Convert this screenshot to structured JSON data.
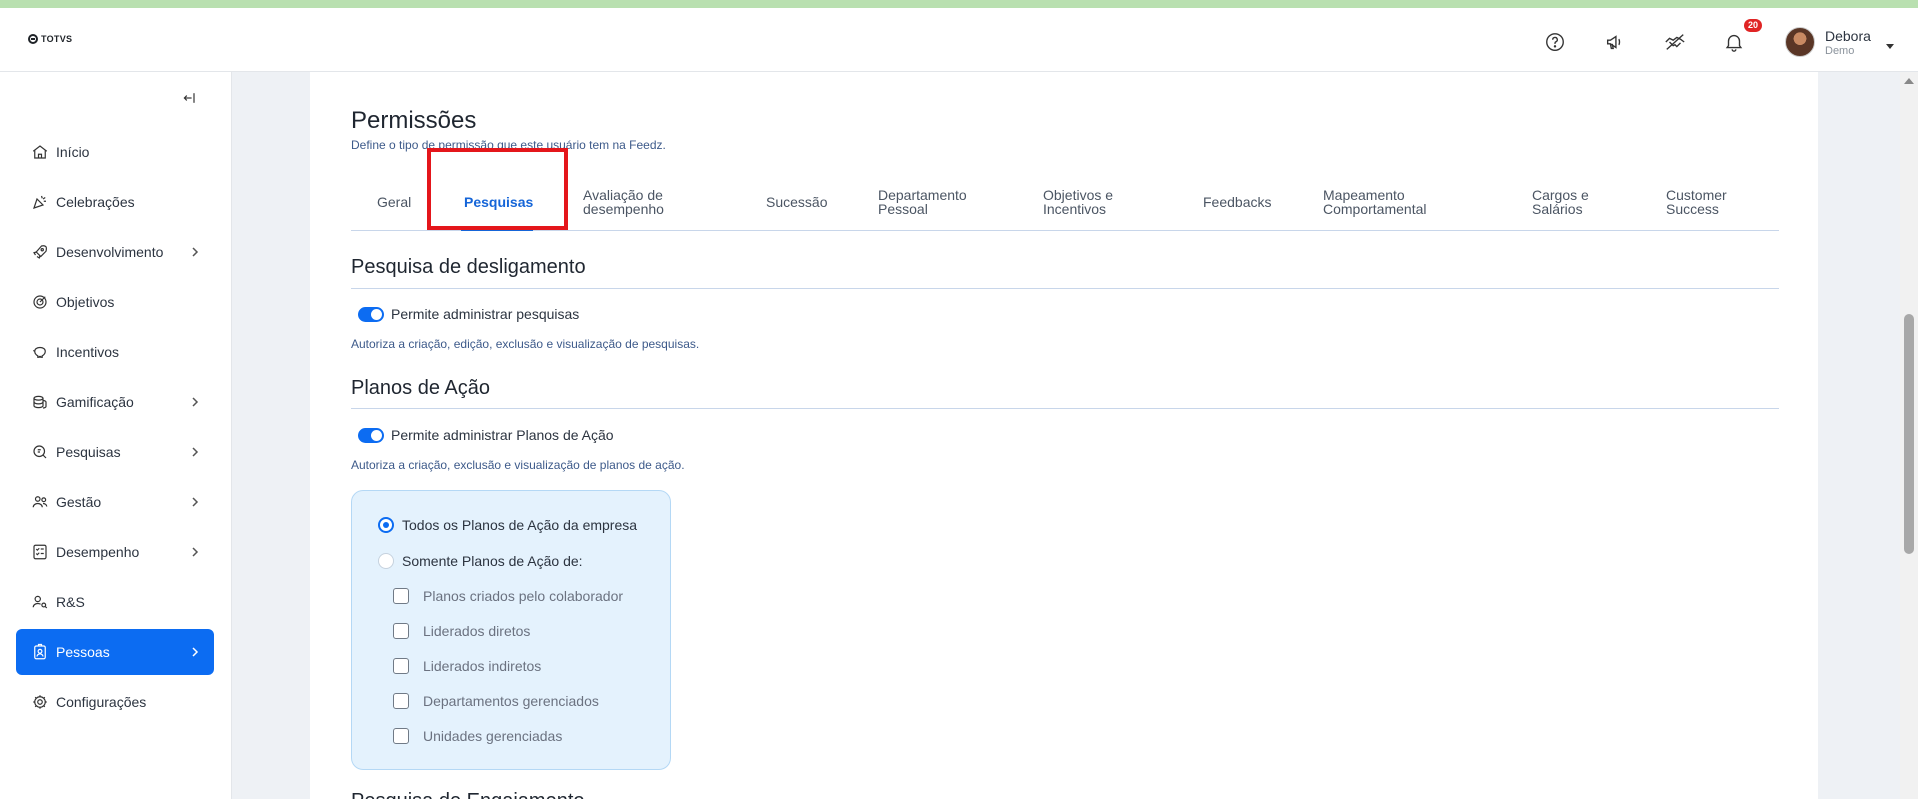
{
  "brand": {
    "logo_text": "TOTVS"
  },
  "header": {
    "icons": [
      "help-icon",
      "megaphone-icon",
      "handshake-icon",
      "bell-icon"
    ],
    "notification_count": "20",
    "user": {
      "name": "Debora",
      "role": "Demo"
    }
  },
  "sidebar": {
    "items": [
      {
        "label": "Início",
        "icon": "home-icon"
      },
      {
        "label": "Celebrações",
        "icon": "party-icon"
      },
      {
        "label": "Desenvolvimento",
        "icon": "rocket-icon"
      },
      {
        "label": "Objetivos",
        "icon": "target-icon"
      },
      {
        "label": "Incentivos",
        "icon": "piggy-bank-icon"
      },
      {
        "label": "Gamificação",
        "icon": "coins-icon"
      },
      {
        "label": "Pesquisas",
        "icon": "survey-icon"
      },
      {
        "label": "Gestão",
        "icon": "people-icon"
      },
      {
        "label": "Desempenho",
        "icon": "checklist-icon"
      },
      {
        "label": "R&S",
        "icon": "user-search-icon"
      },
      {
        "label": "Pessoas",
        "icon": "badge-icon"
      },
      {
        "label": "Configurações",
        "icon": "gear-icon"
      }
    ]
  },
  "page": {
    "title": "Permissões",
    "subtitle": "Define o tipo de permissão que este usuário tem na Feedz."
  },
  "tabs": [
    {
      "label": "Geral"
    },
    {
      "label": "Pesquisas"
    },
    {
      "label1": "Avaliação de",
      "label2": "desempenho"
    },
    {
      "label": "Sucessão"
    },
    {
      "label1": "Departamento",
      "label2": "Pessoal"
    },
    {
      "label1": "Objetivos e",
      "label2": "Incentivos"
    },
    {
      "label": "Feedbacks"
    },
    {
      "label1": "Mapeamento",
      "label2": "Comportamental"
    },
    {
      "label1": "Cargos e",
      "label2": "Salários"
    },
    {
      "label1": "Customer",
      "label2": "Success"
    }
  ],
  "sections": {
    "desligamento": {
      "title": "Pesquisa de desligamento",
      "toggle_label": "Permite administrar pesquisas",
      "toggle_on": true,
      "helper": "Autoriza a criação, edição, exclusão e visualização de pesquisas."
    },
    "planos": {
      "title": "Planos de Ação",
      "toggle_label": "Permite administrar Planos de Ação",
      "toggle_on": true,
      "helper": "Autoriza a criação, exclusão e visualização de planos de ação.",
      "radio_all": "Todos os Planos de Ação da empresa",
      "radio_some": "Somente Planos de Ação de:",
      "checkboxes": [
        "Planos criados pelo colaborador",
        "Liderados diretos",
        "Liderados indiretos",
        "Departamentos gerenciados",
        "Unidades gerenciadas"
      ]
    },
    "next_title": "Pesquisa de Engajamento"
  },
  "colors": {
    "accent": "#0c6cf2",
    "highlight": "#e4161b",
    "badge": "#e02424"
  }
}
